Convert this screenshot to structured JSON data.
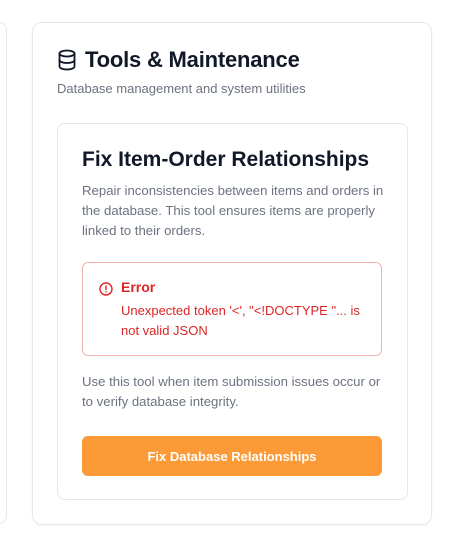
{
  "section": {
    "icon": "database-icon",
    "title": "Tools & Maintenance",
    "subtitle": "Database management and system utilities"
  },
  "tool": {
    "title": "Fix Item-Order Relationships",
    "description": "Repair inconsistencies between items and orders in the database. This tool ensures items are properly linked to their orders.",
    "error": {
      "icon": "alert-circle-icon",
      "title": "Error",
      "message": "Unexpected token '<', \"<!DOCTYPE \"... is not valid JSON"
    },
    "usage_note": "Use this tool when item submission issues occur or to verify database integrity.",
    "button_label": "Fix Database Relationships"
  },
  "colors": {
    "accent": "#fb9a36",
    "error": "#dc2626",
    "error_border": "#f3b3b3",
    "text_primary": "#111827",
    "text_muted": "#6b7280",
    "border": "#e5e7eb"
  }
}
